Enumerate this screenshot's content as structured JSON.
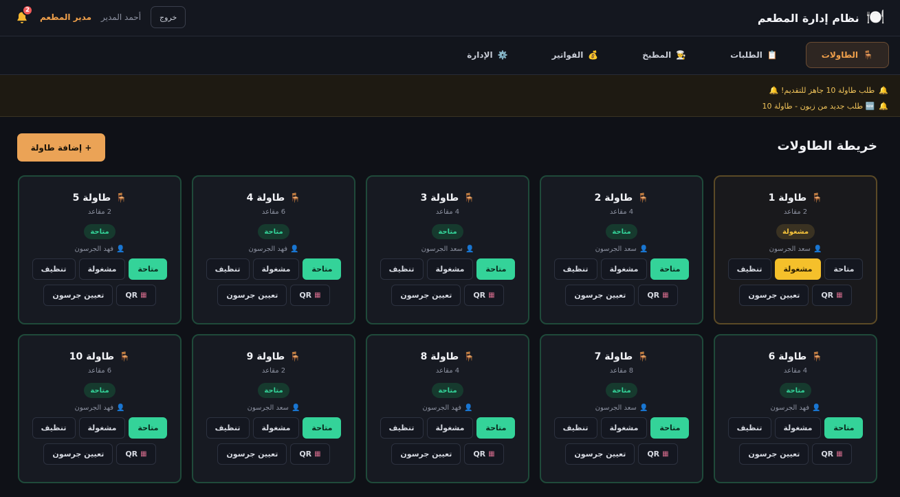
{
  "header": {
    "brand_icon": "🍽️",
    "title": "نظام إدارة المطعم",
    "notifications_count": "2",
    "role": "مدير المطعم",
    "username": "أحمد المدير",
    "logout_label": "خروج"
  },
  "nav": {
    "tabs": [
      {
        "icon": "🪑",
        "label": "الطاولات"
      },
      {
        "icon": "📋",
        "label": "الطلبات"
      },
      {
        "icon": "👨‍🍳",
        "label": "المطبخ"
      },
      {
        "icon": "💰",
        "label": "الفواتير"
      },
      {
        "icon": "⚙️",
        "label": "الإدارة"
      }
    ],
    "active_index": 0
  },
  "notices": [
    {
      "icon": "🔔",
      "text": "طلب طاولة 10 جاهز للتقديم! 🔔"
    },
    {
      "icon": "🔔",
      "text": "🆕 طلب جديد من زبون - طاولة 10"
    }
  ],
  "main": {
    "title": "خريطة الطاولات",
    "add_button": "+ إضافة طاولة",
    "actions": {
      "available": "متاحة",
      "occupied": "مشغولة",
      "cleaning": "تنظيف",
      "qr": "QR",
      "assign": "تعيين جرسون"
    },
    "tables": [
      {
        "name": "طاولة 1",
        "seats": "2 مقاعد",
        "status": "مشغولة",
        "state": "occupied",
        "waiter": "سعد الجرسون"
      },
      {
        "name": "طاولة 2",
        "seats": "4 مقاعد",
        "status": "متاحة",
        "state": "available",
        "waiter": "سعد الجرسون"
      },
      {
        "name": "طاولة 3",
        "seats": "4 مقاعد",
        "status": "متاحة",
        "state": "available",
        "waiter": "سعد الجرسون"
      },
      {
        "name": "طاولة 4",
        "seats": "6 مقاعد",
        "status": "متاحة",
        "state": "available",
        "waiter": "فهد الجرسون"
      },
      {
        "name": "طاولة 5",
        "seats": "2 مقاعد",
        "status": "متاحة",
        "state": "available",
        "waiter": "فهد الجرسون"
      },
      {
        "name": "طاولة 6",
        "seats": "4 مقاعد",
        "status": "متاحة",
        "state": "available",
        "waiter": "فهد الجرسون"
      },
      {
        "name": "طاولة 7",
        "seats": "8 مقاعد",
        "status": "متاحة",
        "state": "available",
        "waiter": "سعد الجرسون"
      },
      {
        "name": "طاولة 8",
        "seats": "4 مقاعد",
        "status": "متاحة",
        "state": "available",
        "waiter": "فهد الجرسون"
      },
      {
        "name": "طاولة 9",
        "seats": "2 مقاعد",
        "status": "متاحة",
        "state": "available",
        "waiter": "سعد الجرسون"
      },
      {
        "name": "طاولة 10",
        "seats": "6 مقاعد",
        "status": "متاحة",
        "state": "available",
        "waiter": "فهد الجرسون"
      }
    ]
  },
  "colors": {
    "accent": "#f0a04b",
    "available": "#34d399",
    "occupied": "#f5c02b",
    "badge": "#ef5a5a"
  }
}
